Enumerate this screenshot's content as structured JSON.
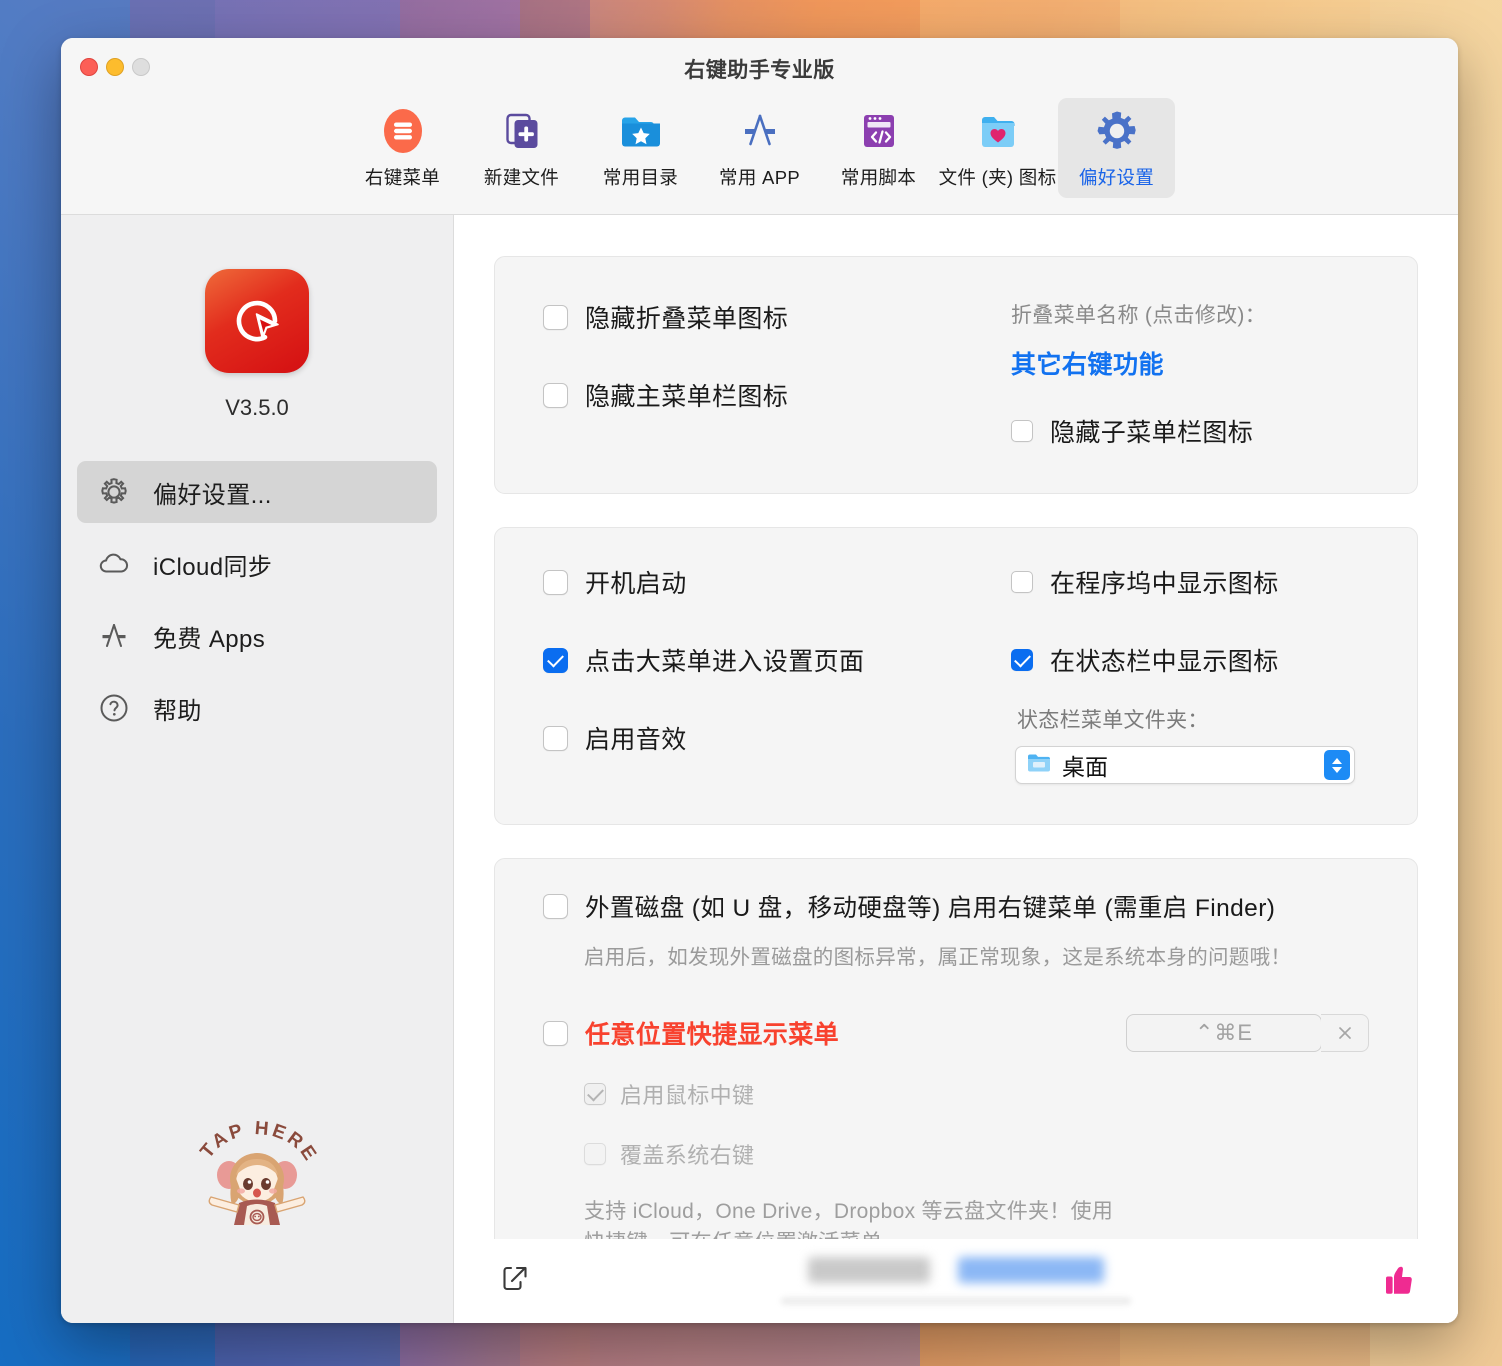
{
  "window": {
    "title": "右键助手专业版",
    "controls": {
      "close": "close",
      "minimize": "minimize",
      "zoom": "zoom"
    }
  },
  "toolbar": {
    "items": [
      {
        "label": "右键菜单",
        "icon": "hamburger-circle-icon",
        "active": false
      },
      {
        "label": "新建文件",
        "icon": "new-file-plus-icon",
        "active": false
      },
      {
        "label": "常用目录",
        "icon": "folder-star-icon",
        "active": false
      },
      {
        "label": "常用 APP",
        "icon": "app-store-icon",
        "active": false
      },
      {
        "label": "常用脚本",
        "icon": "script-code-window-icon",
        "active": false
      },
      {
        "label": "文件 (夹) 图标",
        "icon": "folder-heart-icon",
        "active": false
      },
      {
        "label": "偏好设置",
        "icon": "gear-icon",
        "active": true
      }
    ]
  },
  "sidebar": {
    "app_icon": "cursor-arrow-logo",
    "version": "V3.5.0",
    "items": [
      {
        "label": "偏好设置...",
        "icon": "gear-icon",
        "selected": true
      },
      {
        "label": "iCloud同步",
        "icon": "cloud-icon",
        "selected": false
      },
      {
        "label": "免费 Apps",
        "icon": "app-store-icon",
        "selected": false
      },
      {
        "label": "帮助",
        "icon": "question-circle-icon",
        "selected": false
      }
    ],
    "mascot": {
      "text": "TAP HERE",
      "alt": "tap-here-mascot-sticker"
    }
  },
  "panel_menu_icons": {
    "hide_fold_menu_icon": {
      "label": "隐藏折叠菜单图标",
      "checked": false
    },
    "hide_main_menubar_icon": {
      "label": "隐藏主菜单栏图标",
      "checked": false
    },
    "fold_menu_name_caption": "折叠菜单名称 (点击修改)：",
    "fold_menu_name_value": "其它右键功能",
    "hide_sub_menubar_icon": {
      "label": "隐藏子菜单栏图标",
      "checked": false
    }
  },
  "panel_general": {
    "launch_at_login": {
      "label": "开机启动",
      "checked": false
    },
    "click_big_menu_opens_settings": {
      "label": "点击大菜单进入设置页面",
      "checked": true
    },
    "enable_sound": {
      "label": "启用音效",
      "checked": false
    },
    "show_icon_in_dock": {
      "label": "在程序坞中显示图标",
      "checked": false
    },
    "show_icon_in_statusbar": {
      "label": "在状态栏中显示图标",
      "checked": true
    },
    "statusbar_folder_caption": "状态栏菜单文件夹：",
    "statusbar_folder_value": "桌面"
  },
  "panel_advanced": {
    "external_disk": {
      "label": "外置磁盘 (如 U 盘，移动硬盘等) 启用右键菜单 (需重启 Finder)",
      "checked": false,
      "note": "启用后，如发现外置磁盘的图标异常，属正常现象，这是系统本身的问题哦！"
    },
    "anywhere_shortcut": {
      "label": "任意位置快捷显示菜单",
      "checked": false,
      "color": "#f8422e",
      "hotkey": "⌃⌘E",
      "clear_icon": "close-x-icon"
    },
    "enable_middle_click": {
      "label": "启用鼠标中键",
      "checked": true,
      "disabled": true
    },
    "override_system_rightclick": {
      "label": "覆盖系统右键",
      "checked": false,
      "disabled": true
    },
    "cloud_note_line1": "支持 iCloud，One Drive，Dropbox 等云盘文件夹！使用",
    "cloud_note_line2": "快捷键，可在任意位置激活菜单。"
  },
  "bottombar": {
    "share_icon": "share-export-icon",
    "thumbs_up_icon": "thumbs-up-icon",
    "redacted": [
      "blurred-gray-text",
      "blurred-blue-text"
    ]
  },
  "colors": {
    "accent_blue": "#0a6df0",
    "link_blue": "#1272f0",
    "alert_red": "#f8422e",
    "thumb_pink": "#ef2b91",
    "sidebar_bg": "#efeff0",
    "panel_bg": "#f5f5f5"
  }
}
